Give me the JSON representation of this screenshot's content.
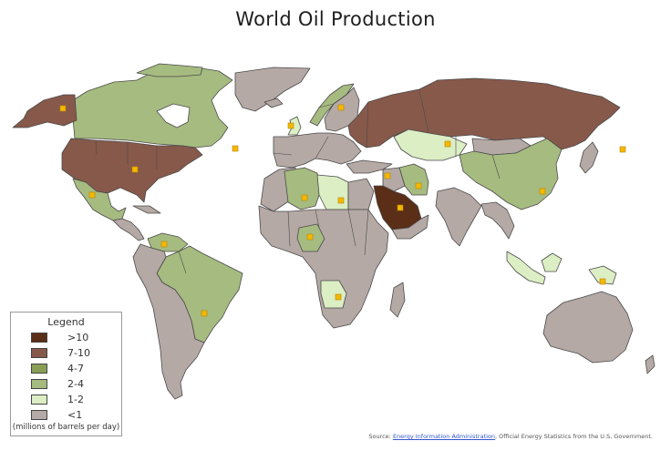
{
  "title": "World Oil Production",
  "legend": {
    "title": "Legend",
    "unit": "(millions of barrels per day)",
    "classes": [
      {
        "label": ">10",
        "color": "#5b2e17"
      },
      {
        "label": "7-10",
        "color": "#87594a"
      },
      {
        "label": "4-7",
        "color": "#889e55"
      },
      {
        "label": "2-4",
        "color": "#a6bb80"
      },
      {
        "label": "1-2",
        "color": "#dbeec4"
      },
      {
        "label": "<1",
        "color": "#b5a9a5"
      }
    ]
  },
  "colors": {
    "ocean": "#ffffff",
    "border": "#4a4a4a",
    "marker": "#f5b800"
  },
  "marker_icon": "oil-well-square-icon",
  "source": {
    "prefix": "Source:",
    "link_text": "Energy Information Administration",
    "suffix": ", Official Energy Statistics from the U.S. Government."
  }
}
